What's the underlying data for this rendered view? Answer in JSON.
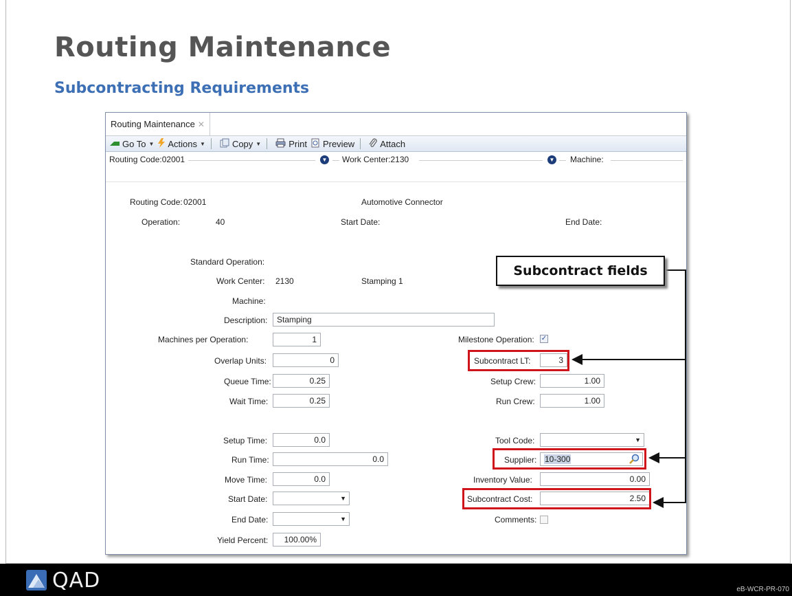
{
  "slide": {
    "title": "Routing Maintenance",
    "subtitle": "Subcontracting Requirements",
    "footer_code": "eB-WCR-PR-070",
    "logo_text": "QAD"
  },
  "window": {
    "tab_label": "Routing Maintenance",
    "toolbar": {
      "goto": "Go To",
      "actions": "Actions",
      "copy": "Copy",
      "print": "Print",
      "preview": "Preview",
      "attach": "Attach"
    },
    "crumbs": {
      "routing": "Routing Code:02001",
      "workcenter": "Work Center:2130",
      "machine": "Machine:"
    }
  },
  "header": {
    "routing_code_label": "Routing Code:",
    "routing_code": "02001",
    "description_text": "Automotive Connector",
    "operation_label": "Operation:",
    "operation": "40",
    "start_date_label": "Start Date:",
    "end_date_label": "End Date:"
  },
  "form": {
    "standard_operation_label": "Standard Operation:",
    "work_center_label": "Work Center:",
    "work_center": "2130",
    "work_center_desc": "Stamping 1",
    "machine_label": "Machine:",
    "description_label": "Description:",
    "description": "Stamping",
    "machines_per_op_label": "Machines per Operation:",
    "machines_per_op": "1",
    "overlap_units_label": "Overlap Units:",
    "overlap_units": "0",
    "queue_time_label": "Queue Time:",
    "queue_time": "0.25",
    "wait_time_label": "Wait Time:",
    "wait_time": "0.25",
    "setup_time_label": "Setup Time:",
    "setup_time": "0.0",
    "run_time_label": "Run Time:",
    "run_time": "0.0",
    "move_time_label": "Move Time:",
    "move_time": "0.0",
    "start_date_label": "Start Date:",
    "end_date_label": "End Date:",
    "yield_percent_label": "Yield Percent:",
    "yield_percent": "100.00%",
    "milestone_label": "Milestone Operation:",
    "milestone_checked": true,
    "subcontract_lt_label": "Subcontract LT:",
    "subcontract_lt": "3",
    "setup_crew_label": "Setup Crew:",
    "setup_crew": "1.00",
    "run_crew_label": "Run Crew:",
    "run_crew": "1.00",
    "tool_code_label": "Tool Code:",
    "supplier_label": "Supplier:",
    "supplier": "10-300",
    "inventory_value_label": "Inventory Value:",
    "inventory_value": "0.00",
    "subcontract_cost_label": "Subcontract Cost:",
    "subcontract_cost": "2.50",
    "comments_label": "Comments:",
    "comments_checked": false
  },
  "callout": {
    "text": "Subcontract fields"
  },
  "colors": {
    "highlight": "#d0141c",
    "subtitle": "#3d6fb5"
  }
}
